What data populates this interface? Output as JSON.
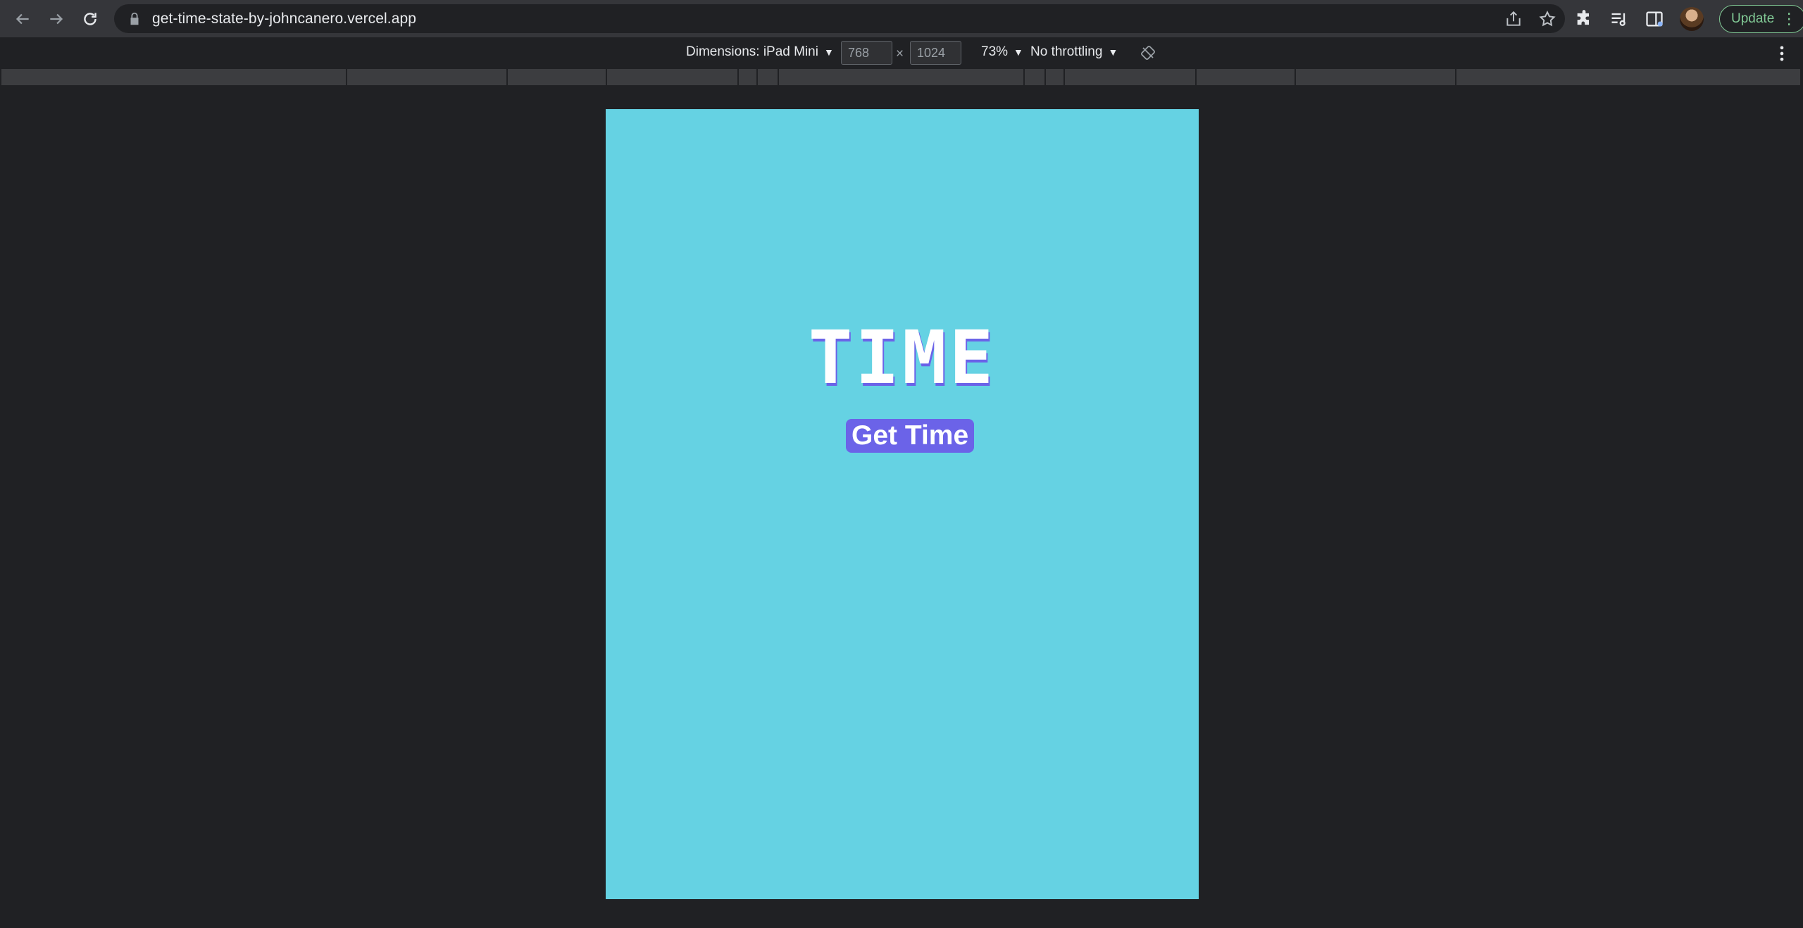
{
  "browser": {
    "url": "get-time-state-by-johncanero.vercel.app",
    "update_label": "Update"
  },
  "devtools": {
    "dimensions_label": "Dimensions: iPad Mini",
    "width_value": "768",
    "height_value": "1024",
    "times_symbol": "×",
    "zoom_label": "73%",
    "throttle_label": "No throttling"
  },
  "page": {
    "background_color": "#65d2e3",
    "accent_color": "#6b63e8",
    "title": "TIME",
    "button_label": "Get Time"
  }
}
